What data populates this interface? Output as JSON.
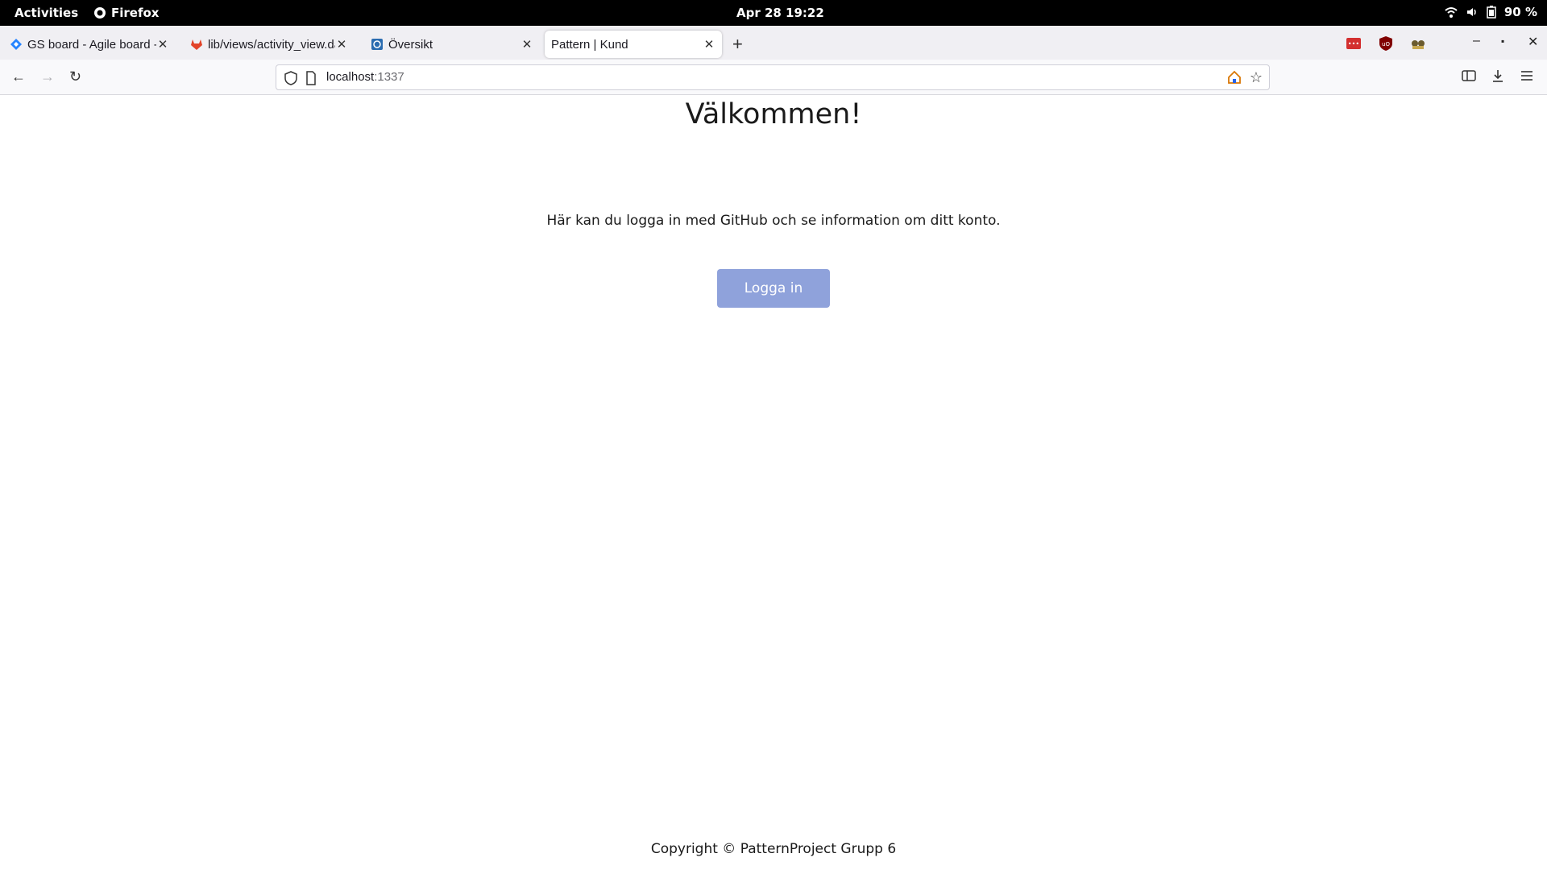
{
  "system": {
    "activities": "Activities",
    "app_name": "Firefox",
    "clock": "Apr 28  19:22",
    "battery": "90 %"
  },
  "tabs": [
    {
      "title": "GS board - Agile board - J",
      "icon": "jira-icon",
      "active": false
    },
    {
      "title": "lib/views/activity_view.da",
      "icon": "gitlab-icon",
      "active": false
    },
    {
      "title": "Översikt",
      "icon": "globe-icon",
      "active": false
    },
    {
      "title": "Pattern | Kund",
      "icon": "",
      "active": true
    }
  ],
  "address_bar": {
    "host": "localhost",
    "port": ":1337"
  },
  "page": {
    "heading": "Välkommen!",
    "info": "Här kan du logga in med GitHub och se information om ditt konto.",
    "login_label": "Logga in",
    "footer": "Copyright © PatternProject Grupp 6"
  },
  "colors": {
    "login_button": "#8fa2db",
    "top_bar": "#000000",
    "tab_strip": "#f0eff3"
  }
}
